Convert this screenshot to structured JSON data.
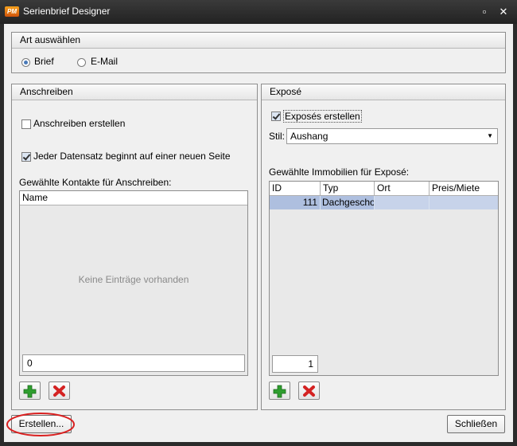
{
  "window": {
    "title": "Serienbrief Designer",
    "logo_text": "PM",
    "minimize_label": "▫",
    "close_label": "✕"
  },
  "art": {
    "header": "Art auswählen",
    "options": [
      {
        "label": "Brief",
        "selected": true
      },
      {
        "label": "E-Mail",
        "selected": false
      }
    ]
  },
  "anschreiben": {
    "header": "Anschreiben",
    "create_label": "Anschreiben erstellen",
    "create_checked": false,
    "newpage_label": "Jeder Datensatz beginnt auf einer neuen Seite",
    "newpage_checked": true,
    "contacts_label": "Gewählte Kontakte für Anschreiben:",
    "columns": [
      "Name"
    ],
    "empty_text": "Keine Einträge vorhanden",
    "count": "0"
  },
  "expose": {
    "header": "Exposé",
    "create_label": "Exposés erstellen",
    "create_checked": true,
    "style_label": "Stil:",
    "style_value": "Aushang",
    "properties_label": "Gewählte Immobilien für Exposé:",
    "columns": [
      "ID",
      "Typ",
      "Ort",
      "Preis/Miete"
    ],
    "rows": [
      {
        "id": "111",
        "typ": "Dachgeschos",
        "ort": "",
        "preis": ""
      }
    ],
    "count": "1"
  },
  "buttons": {
    "create": "Erstellen...",
    "close": "Schließen"
  },
  "colors": {
    "selection": "#aebfdf",
    "title_bar": "#2b2b2b",
    "add_icon": "#2e9e2e",
    "remove_icon": "#d42222",
    "highlight_ring": "#d92020"
  }
}
